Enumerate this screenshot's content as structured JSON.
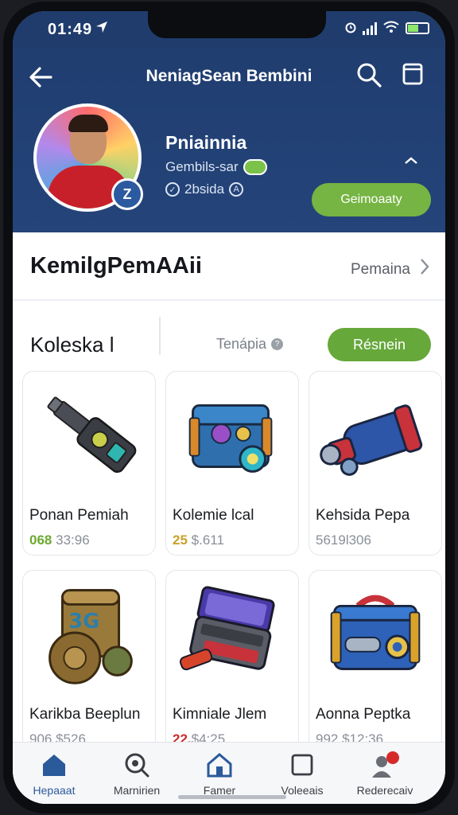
{
  "status": {
    "time": "01:49",
    "location_icon": "location-arrow-icon",
    "battery_color": "#8ee66b"
  },
  "header": {
    "title": "NeniagSean Bembini",
    "back_icon": "back-arrow-icon",
    "search_icon": "search-icon",
    "cart_icon": "bag-icon",
    "bg_color": "#1f3c6d"
  },
  "profile": {
    "name": "Pniainnia",
    "subtitle": "Gembils-sar",
    "meta": "2bsida",
    "badge": "Z",
    "follow_label": "Geimoaaty",
    "accent": "#76b543"
  },
  "section": {
    "title": "KemilgPemAAii",
    "link_label": "Pemaina"
  },
  "collection": {
    "title": "Koleska l",
    "filter_label": "Tenápia",
    "button_label": "Résnein",
    "button_color": "#66a83a"
  },
  "items": [
    {
      "name": "Ponan Pemiah",
      "price_hl": "068",
      "price": "33:96",
      "hl_color": "#6aaa2e",
      "art": "flashlight"
    },
    {
      "name": "Kolemie lcal",
      "price_hl": "25",
      "price": "$.611",
      "hl_color": "#c9a12a",
      "art": "chest-blue"
    },
    {
      "name": "Kehsida Pepa",
      "price_hl": "",
      "price": "5619l306",
      "hl_color": "#8a8f98",
      "art": "cannon"
    },
    {
      "name": "Karikba Beeplun",
      "price_hl": "",
      "price": "906 $526",
      "hl_color": "#8a8f98",
      "art": "barrel"
    },
    {
      "name": "Kimniale Jlem",
      "price_hl": "22.",
      "price": "$4:25",
      "hl_color": "#cc2a2a",
      "art": "chest-red"
    },
    {
      "name": "Aonna Peptka",
      "price_hl": "",
      "price": "992 $12:36",
      "hl_color": "#8a8f98",
      "art": "toolbox"
    }
  ],
  "nav": [
    {
      "label": "Hepaaat",
      "icon": "home-icon",
      "active": true
    },
    {
      "label": "Marnirien",
      "icon": "search-icon",
      "active": false
    },
    {
      "label": "Famer",
      "icon": "house-icon",
      "active": false
    },
    {
      "label": "Voleeais",
      "icon": "square-icon",
      "active": false
    },
    {
      "label": "Rederecaiv",
      "icon": "profile-notification-icon",
      "active": false
    }
  ]
}
